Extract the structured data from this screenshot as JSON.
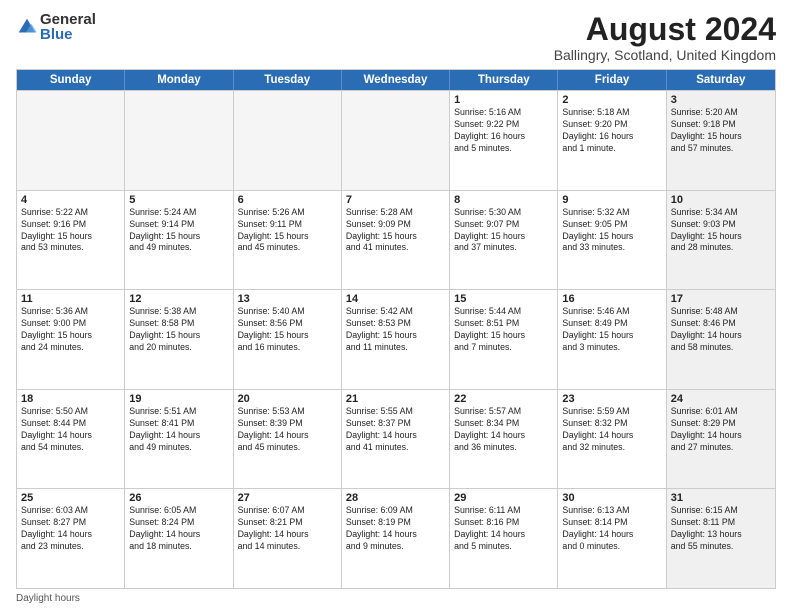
{
  "logo": {
    "general": "General",
    "blue": "Blue"
  },
  "title": {
    "month": "August 2024",
    "location": "Ballingry, Scotland, United Kingdom"
  },
  "header_days": [
    "Sunday",
    "Monday",
    "Tuesday",
    "Wednesday",
    "Thursday",
    "Friday",
    "Saturday"
  ],
  "footer": "Daylight hours",
  "weeks": [
    [
      {
        "day": "",
        "info": "",
        "empty": true
      },
      {
        "day": "",
        "info": "",
        "empty": true
      },
      {
        "day": "",
        "info": "",
        "empty": true
      },
      {
        "day": "",
        "info": "",
        "empty": true
      },
      {
        "day": "1",
        "info": "Sunrise: 5:16 AM\nSunset: 9:22 PM\nDaylight: 16 hours\nand 5 minutes."
      },
      {
        "day": "2",
        "info": "Sunrise: 5:18 AM\nSunset: 9:20 PM\nDaylight: 16 hours\nand 1 minute."
      },
      {
        "day": "3",
        "info": "Sunrise: 5:20 AM\nSunset: 9:18 PM\nDaylight: 15 hours\nand 57 minutes.",
        "shaded": true
      }
    ],
    [
      {
        "day": "4",
        "info": "Sunrise: 5:22 AM\nSunset: 9:16 PM\nDaylight: 15 hours\nand 53 minutes."
      },
      {
        "day": "5",
        "info": "Sunrise: 5:24 AM\nSunset: 9:14 PM\nDaylight: 15 hours\nand 49 minutes."
      },
      {
        "day": "6",
        "info": "Sunrise: 5:26 AM\nSunset: 9:11 PM\nDaylight: 15 hours\nand 45 minutes."
      },
      {
        "day": "7",
        "info": "Sunrise: 5:28 AM\nSunset: 9:09 PM\nDaylight: 15 hours\nand 41 minutes."
      },
      {
        "day": "8",
        "info": "Sunrise: 5:30 AM\nSunset: 9:07 PM\nDaylight: 15 hours\nand 37 minutes."
      },
      {
        "day": "9",
        "info": "Sunrise: 5:32 AM\nSunset: 9:05 PM\nDaylight: 15 hours\nand 33 minutes."
      },
      {
        "day": "10",
        "info": "Sunrise: 5:34 AM\nSunset: 9:03 PM\nDaylight: 15 hours\nand 28 minutes.",
        "shaded": true
      }
    ],
    [
      {
        "day": "11",
        "info": "Sunrise: 5:36 AM\nSunset: 9:00 PM\nDaylight: 15 hours\nand 24 minutes."
      },
      {
        "day": "12",
        "info": "Sunrise: 5:38 AM\nSunset: 8:58 PM\nDaylight: 15 hours\nand 20 minutes."
      },
      {
        "day": "13",
        "info": "Sunrise: 5:40 AM\nSunset: 8:56 PM\nDaylight: 15 hours\nand 16 minutes."
      },
      {
        "day": "14",
        "info": "Sunrise: 5:42 AM\nSunset: 8:53 PM\nDaylight: 15 hours\nand 11 minutes."
      },
      {
        "day": "15",
        "info": "Sunrise: 5:44 AM\nSunset: 8:51 PM\nDaylight: 15 hours\nand 7 minutes."
      },
      {
        "day": "16",
        "info": "Sunrise: 5:46 AM\nSunset: 8:49 PM\nDaylight: 15 hours\nand 3 minutes."
      },
      {
        "day": "17",
        "info": "Sunrise: 5:48 AM\nSunset: 8:46 PM\nDaylight: 14 hours\nand 58 minutes.",
        "shaded": true
      }
    ],
    [
      {
        "day": "18",
        "info": "Sunrise: 5:50 AM\nSunset: 8:44 PM\nDaylight: 14 hours\nand 54 minutes."
      },
      {
        "day": "19",
        "info": "Sunrise: 5:51 AM\nSunset: 8:41 PM\nDaylight: 14 hours\nand 49 minutes."
      },
      {
        "day": "20",
        "info": "Sunrise: 5:53 AM\nSunset: 8:39 PM\nDaylight: 14 hours\nand 45 minutes."
      },
      {
        "day": "21",
        "info": "Sunrise: 5:55 AM\nSunset: 8:37 PM\nDaylight: 14 hours\nand 41 minutes."
      },
      {
        "day": "22",
        "info": "Sunrise: 5:57 AM\nSunset: 8:34 PM\nDaylight: 14 hours\nand 36 minutes."
      },
      {
        "day": "23",
        "info": "Sunrise: 5:59 AM\nSunset: 8:32 PM\nDaylight: 14 hours\nand 32 minutes."
      },
      {
        "day": "24",
        "info": "Sunrise: 6:01 AM\nSunset: 8:29 PM\nDaylight: 14 hours\nand 27 minutes.",
        "shaded": true
      }
    ],
    [
      {
        "day": "25",
        "info": "Sunrise: 6:03 AM\nSunset: 8:27 PM\nDaylight: 14 hours\nand 23 minutes."
      },
      {
        "day": "26",
        "info": "Sunrise: 6:05 AM\nSunset: 8:24 PM\nDaylight: 14 hours\nand 18 minutes."
      },
      {
        "day": "27",
        "info": "Sunrise: 6:07 AM\nSunset: 8:21 PM\nDaylight: 14 hours\nand 14 minutes."
      },
      {
        "day": "28",
        "info": "Sunrise: 6:09 AM\nSunset: 8:19 PM\nDaylight: 14 hours\nand 9 minutes."
      },
      {
        "day": "29",
        "info": "Sunrise: 6:11 AM\nSunset: 8:16 PM\nDaylight: 14 hours\nand 5 minutes."
      },
      {
        "day": "30",
        "info": "Sunrise: 6:13 AM\nSunset: 8:14 PM\nDaylight: 14 hours\nand 0 minutes."
      },
      {
        "day": "31",
        "info": "Sunrise: 6:15 AM\nSunset: 8:11 PM\nDaylight: 13 hours\nand 55 minutes.",
        "shaded": true
      }
    ]
  ]
}
